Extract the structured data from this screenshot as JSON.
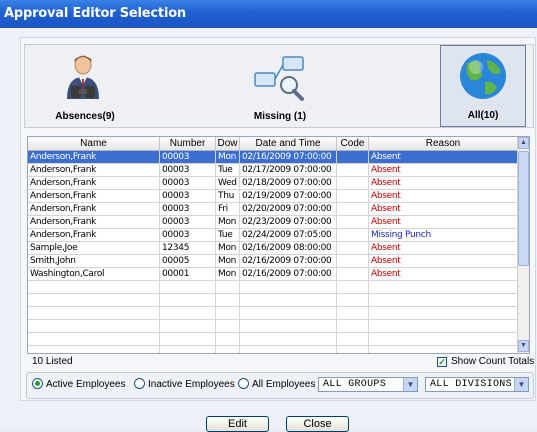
{
  "window": {
    "title": "Approval Editor Selection"
  },
  "toolbar": {
    "absences_label": "Absences(9)",
    "missing_label": "Missing (1)",
    "all_label": "All(10)"
  },
  "grid": {
    "columns": [
      "Name",
      "Number",
      "Dow",
      "Date and Time",
      "Code",
      "Reason"
    ],
    "rows": [
      {
        "name": "Anderson,Frank",
        "number": "00003",
        "dow": "Mon",
        "datetime": "02/16/2009 07:00:00",
        "code": "",
        "reason": "Absent"
      },
      {
        "name": "Anderson,Frank",
        "number": "00003",
        "dow": "Tue",
        "datetime": "02/17/2009 07:00:00",
        "code": "",
        "reason": "Absent"
      },
      {
        "name": "Anderson,Frank",
        "number": "00003",
        "dow": "Wed",
        "datetime": "02/18/2009 07:00:00",
        "code": "",
        "reason": "Absent"
      },
      {
        "name": "Anderson,Frank",
        "number": "00003",
        "dow": "Thu",
        "datetime": "02/19/2009 07:00:00",
        "code": "",
        "reason": "Absent"
      },
      {
        "name": "Anderson,Frank",
        "number": "00003",
        "dow": "Fri",
        "datetime": "02/20/2009 07:00:00",
        "code": "",
        "reason": "Absent"
      },
      {
        "name": "Anderson,Frank",
        "number": "00003",
        "dow": "Mon",
        "datetime": "02/23/2009 07:00:00",
        "code": "",
        "reason": "Absent"
      },
      {
        "name": "Anderson,Frank",
        "number": "00003",
        "dow": "Tue",
        "datetime": "02/24/2009 07:05:00",
        "code": "",
        "reason": "Missing Punch"
      },
      {
        "name": "Sample,Joe",
        "number": "12345",
        "dow": "Mon",
        "datetime": "02/16/2009 08:00:00",
        "code": "",
        "reason": "Absent"
      },
      {
        "name": "Smith,John",
        "number": "00005",
        "dow": "Mon",
        "datetime": "02/16/2009 07:00:00",
        "code": "",
        "reason": "Absent"
      },
      {
        "name": "Washington,Carol",
        "number": "00001",
        "dow": "Mon",
        "datetime": "02/16/2009 07:00:00",
        "code": "",
        "reason": "Absent"
      }
    ]
  },
  "status": {
    "listed": "10 Listed",
    "show_count_totals": "Show Count Totals"
  },
  "filters": {
    "active": "Active Employees",
    "inactive": "Inactive Employees",
    "all": "All Employees",
    "groups": "ALL GROUPS",
    "divisions": "ALL DIVISIONS"
  },
  "buttons": {
    "edit": "Edit",
    "close": "Close"
  },
  "colors": {
    "title_bar": "#1f5fcf",
    "selected_row": "#3b6ed0",
    "absent": "#c00000",
    "missing": "#1a29c0"
  }
}
